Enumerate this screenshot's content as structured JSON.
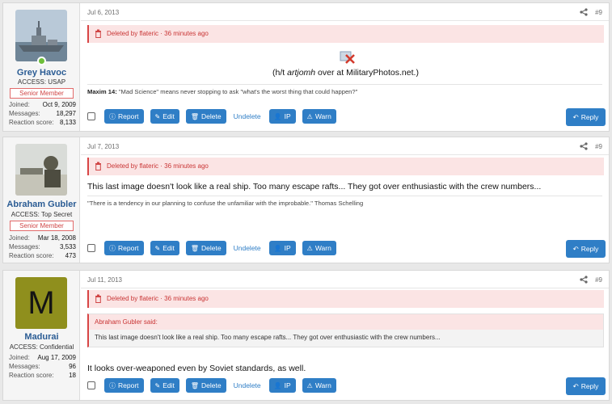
{
  "colors": {
    "accent": "#2f7ec6",
    "deleted_bg": "#fbe4e4",
    "deleted_text": "#c93535",
    "username": "#2b5c94"
  },
  "stat_labels": {
    "joined": "Joined:",
    "messages": "Messages:",
    "reaction": "Reaction score:"
  },
  "buttons": {
    "report": "Report",
    "edit": "Edit",
    "delete": "Delete",
    "undelete": "Undelete",
    "ip": "IP",
    "warn": "Warn",
    "reply": "Reply"
  },
  "posts": [
    {
      "date": "Jul 6, 2013",
      "number": "#9",
      "deleted_notice": "Deleted by flateric · 36 minutes ago",
      "user": {
        "name": "Grey Havoc",
        "title": "ACCESS: USAP",
        "badge": "Senior Member",
        "joined": "Oct 9, 2009",
        "messages": "18,297",
        "reaction": "8,133",
        "avatar": "warship-photo-avatar",
        "online": true
      },
      "image_icon": "broken-image-icon",
      "caption_prefix": "(h/t ",
      "caption_em": "artjomh",
      "caption_suffix": " over at MilitaryPhotos.net.)",
      "sig_bold": "Maxim 14:",
      "sig_text": " \"Mad Science\" means never stopping to ask \"what's the worst thing that could happen?\""
    },
    {
      "date": "Jul 7, 2013",
      "number": "#9",
      "deleted_notice": "Deleted by flateric · 36 minutes ago",
      "user": {
        "name": "Abraham Gubler",
        "title": "ACCESS: Top Secret",
        "badge": "Senior Member",
        "joined": "Mar 18, 2008",
        "messages": "3,533",
        "reaction": "473",
        "avatar": "soldier-photo-avatar"
      },
      "text": "This last image doesn't look like a real ship. Too many escape rafts... They got over enthusiastic with the crew numbers...",
      "sig_text": "\"There is a tendency in our planning to confuse the unfamiliar with the improbable.\" Thomas Schelling"
    },
    {
      "date": "Jul 11, 2013",
      "number": "#9",
      "deleted_notice": "Deleted by flateric · 36 minutes ago",
      "user": {
        "name": "Madurai",
        "title": "ACCESS: Confidential",
        "joined": "Aug 17, 2009",
        "messages": "96",
        "reaction": "18",
        "avatar_letter": "M",
        "avatar_color": "#8f8f1d"
      },
      "quote_author": "Abraham Gubler said:",
      "quote_text": "This last image doesn't look like a real ship. Too many escape rafts... They got over enthusiastic with the crew numbers...",
      "text": "It looks over-weaponed even by Soviet standards, as well."
    }
  ]
}
